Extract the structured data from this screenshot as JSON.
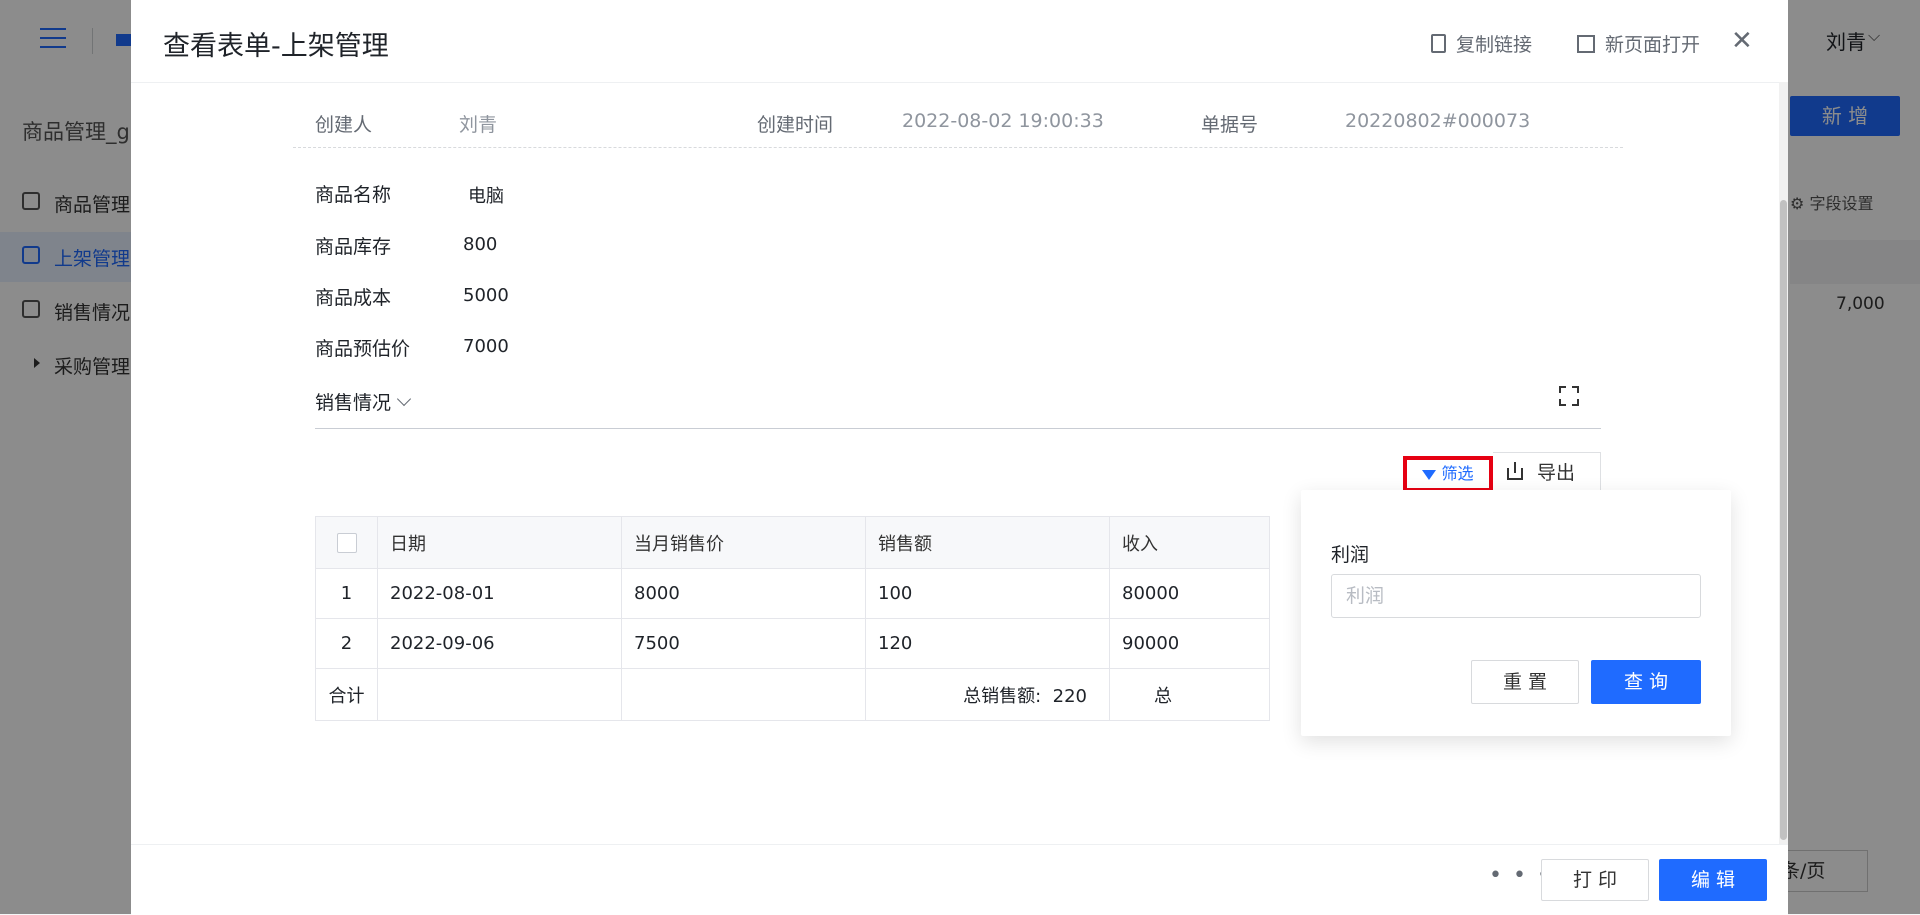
{
  "background_app": {
    "app_title": "商品管理_g",
    "user_name": "刘青",
    "nav_items": [
      {
        "label": "商品管理"
      },
      {
        "label": "上架管理"
      },
      {
        "label": "销售情况"
      },
      {
        "label": "采购管理"
      }
    ],
    "add_button": "新 增",
    "field_settings": "字段设置",
    "table_value": "7,000",
    "page_size": "条/页"
  },
  "modal": {
    "title": "查看表单-上架管理",
    "copy_link": "复制链接",
    "open_new_page": "新页面打开",
    "meta": {
      "creator_label": "创建人",
      "creator_value": "刘青",
      "created_time_label": "创建时间",
      "created_time_value": "2022-08-02 19:00:33",
      "doc_no_label": "单据号",
      "doc_no_value": "20220802#000073"
    },
    "fields": [
      {
        "label": "商品名称",
        "value": "电脑"
      },
      {
        "label": "商品库存",
        "value": "800"
      },
      {
        "label": "商品成本",
        "value": "5000"
      },
      {
        "label": "商品预估价",
        "value": "7000"
      }
    ],
    "sales_section": {
      "title": "销售情况",
      "filter_label": "筛选",
      "export_label": "导出",
      "columns": [
        "日期",
        "当月销售价",
        "销售额",
        "收入"
      ],
      "rows": [
        {
          "index": "1",
          "date": "2022-08-01",
          "price": "8000",
          "sales": "100",
          "income": "80000"
        },
        {
          "index": "2",
          "date": "2022-09-06",
          "price": "7500",
          "sales": "120",
          "income": "90000"
        }
      ],
      "total_label": "合计",
      "total_sales_label": "总销售额:",
      "total_sales_value": "220",
      "total_income_partial": "总"
    },
    "filter_popover": {
      "field_label": "利润",
      "placeholder": "利润",
      "reset": "重 置",
      "query": "查 询"
    },
    "footer": {
      "more": "• • •",
      "print": "打 印",
      "edit": "编 辑"
    }
  },
  "colors": {
    "primary": "#1f6bff",
    "highlight_box": "#e60012"
  }
}
